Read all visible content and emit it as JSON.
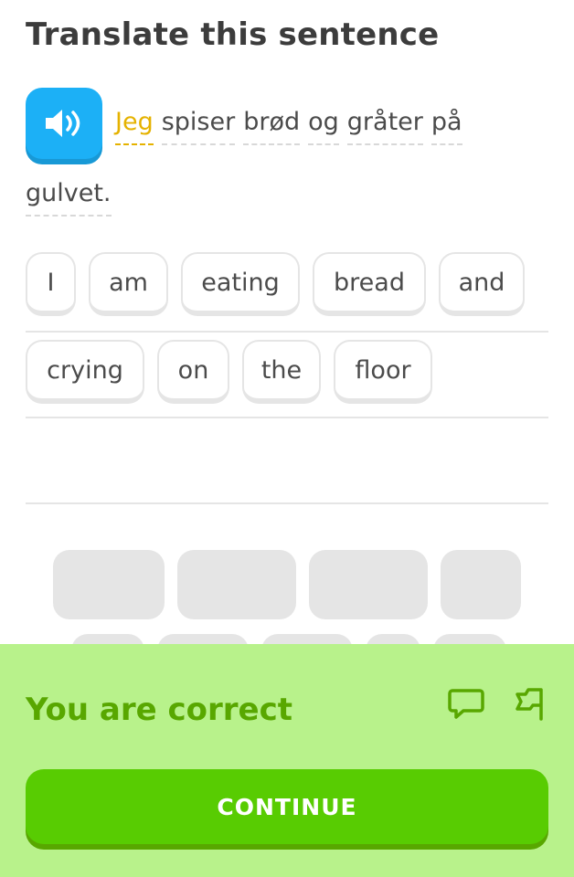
{
  "header": {
    "title": "Translate this sentence"
  },
  "prompt": {
    "speaker_icon": "speaker-icon",
    "line1": [
      "Jeg",
      "spiser",
      "brød",
      "og",
      "gråter",
      "på"
    ],
    "line2": [
      "gulvet."
    ],
    "highlight_word": "Jeg",
    "highlight_color": "#e5b200"
  },
  "answer": {
    "row1": [
      "I",
      "am",
      "eating",
      "bread",
      "and"
    ],
    "row2": [
      "crying",
      "on",
      "the",
      "floor"
    ]
  },
  "feedback": {
    "status": "You are correct",
    "comment_icon": "comment-icon",
    "flag_icon": "flag-icon",
    "continue_label": "CONTINUE",
    "accent_color": "#58cc02",
    "background_color": "#b8f28b",
    "text_color": "#58a700"
  },
  "colors": {
    "speaker_button": "#1cb0f6"
  }
}
